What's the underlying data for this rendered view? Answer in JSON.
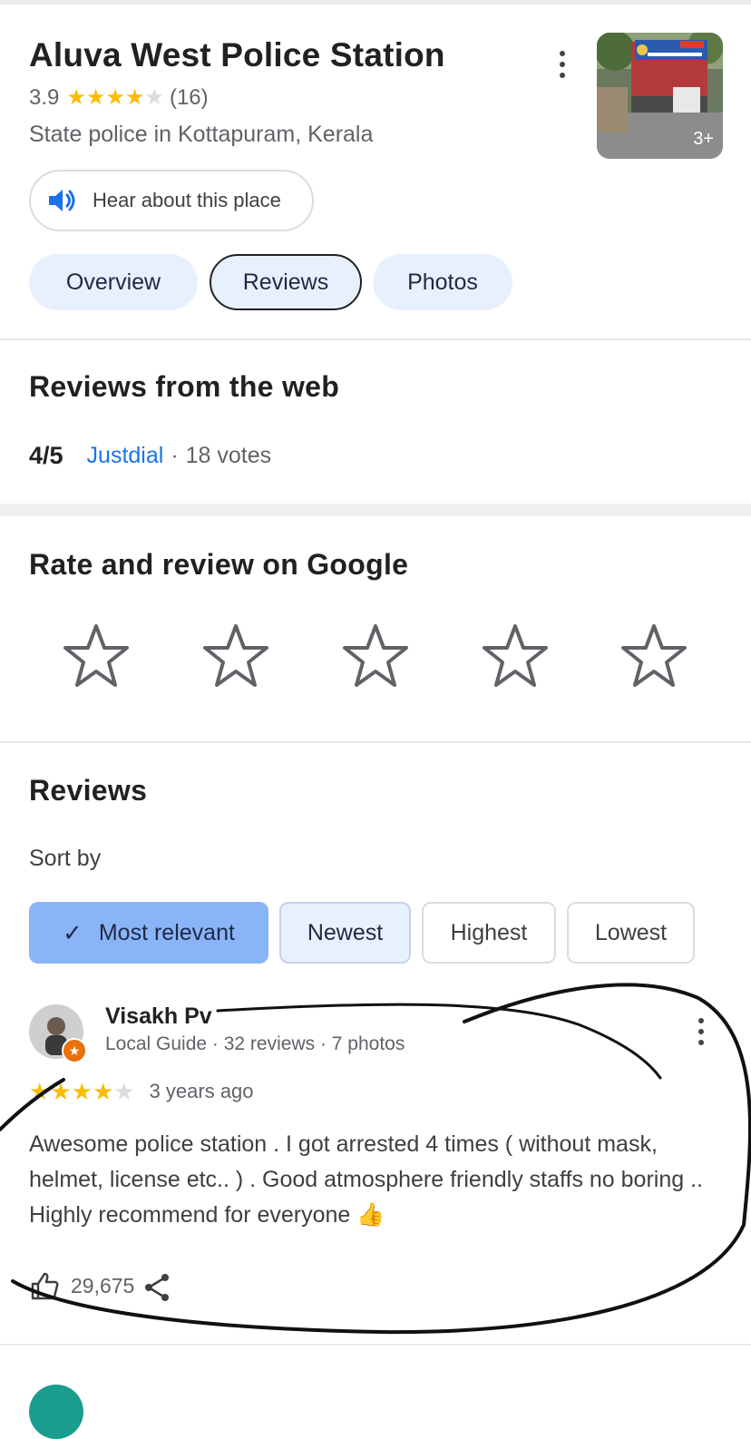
{
  "place": {
    "name": "Aluva West Police Station",
    "rating": "3.9",
    "rating_value": 3.9,
    "review_count": "(16)",
    "category": "State police in Kottapuram, Kerala",
    "photo_count": "3+"
  },
  "hear_button": {
    "label": "Hear about this place"
  },
  "tabs": [
    {
      "label": "Overview",
      "active": false
    },
    {
      "label": "Reviews",
      "active": true
    },
    {
      "label": "Photos",
      "active": false
    }
  ],
  "web_reviews": {
    "heading": "Reviews from the web",
    "score": "4/5",
    "source": "Justdial",
    "separator": "·",
    "votes": "18 votes"
  },
  "rate": {
    "heading": "Rate and review on Google",
    "stars": 5
  },
  "reviews": {
    "heading": "Reviews",
    "sort_label": "Sort by",
    "sort_options": [
      {
        "label": "Most relevant",
        "selected": true
      },
      {
        "label": "Newest",
        "selected": false
      },
      {
        "label": "Highest",
        "selected": false
      },
      {
        "label": "Lowest",
        "selected": false
      }
    ],
    "items": [
      {
        "author": "Visakh Pv",
        "meta": "Local Guide · 32 reviews · 7 photos",
        "rating": 4,
        "time": "3 years ago",
        "text": "Awesome police station . I got arrested 4 times ( without mask, helmet, license etc.. ) . Good atmosphere friendly staffs no boring .. Highly recommend for everyone 👍",
        "likes": "29,675"
      }
    ]
  },
  "colors": {
    "star": "#fbbc04",
    "link": "#1a73e8",
    "chip_selected": "#8ab4f8",
    "tab_bg": "#e8f0fe"
  }
}
